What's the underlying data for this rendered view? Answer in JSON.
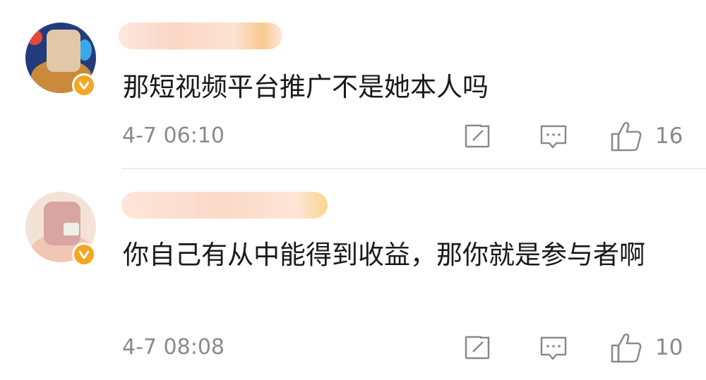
{
  "comments": [
    {
      "text": "那短视频平台推广不是她本人吗",
      "time": "4-7 06:10",
      "likes": "16",
      "verified": true
    },
    {
      "text": "你自己有从中能得到收益，那你就是参与者啊",
      "time": "4-7 08:08",
      "likes": "10",
      "verified": true
    }
  ],
  "icons": {
    "repost": "repost-icon",
    "reply": "comment-icon",
    "like": "thumbs-up-icon",
    "verified": "verified-badge-icon"
  },
  "colors": {
    "text": "#1a1a1a",
    "meta": "#8a8a8a",
    "verified_badge": "#f5a623",
    "divider": "#ededed"
  }
}
